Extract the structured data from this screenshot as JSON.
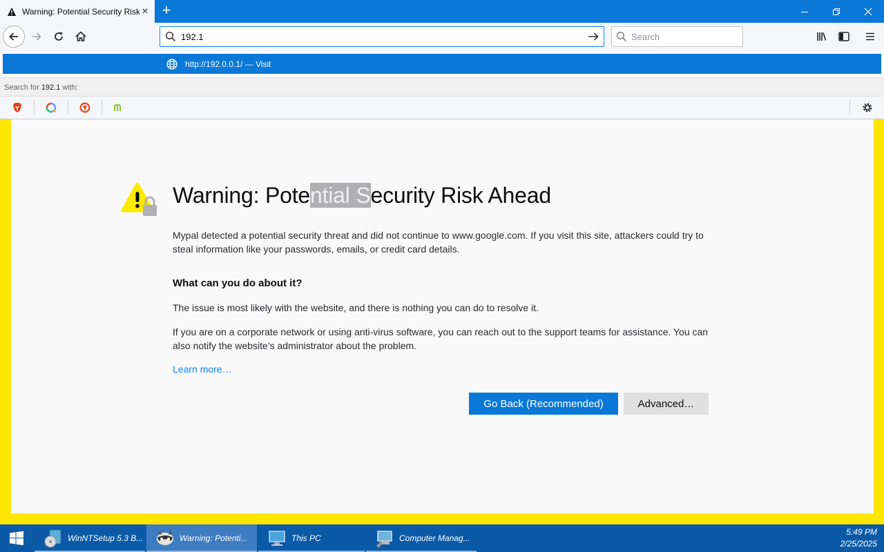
{
  "browser": {
    "tab": {
      "title": "Warning: Potential Security Risk A",
      "icon": "warning-icon"
    },
    "window_controls": [
      "minimize-icon",
      "restore-icon",
      "close-icon"
    ],
    "address_bar": {
      "value": "192.1"
    },
    "search_bar": {
      "placeholder": "Search"
    }
  },
  "url_dropdown": {
    "selected": {
      "url": "http://192.0.0.1/ — Visit",
      "icon": "globe-icon"
    },
    "search_for": {
      "prefix": "Search for",
      "query": "192.1",
      "suffix": "with:"
    },
    "engines": [
      "brave-icon",
      "qwant-icon",
      "duckduckgo-icon",
      "mojeek-icon"
    ]
  },
  "page": {
    "title_pre": "Warning: Pote",
    "title_hl": "ntial S",
    "title_post": "ecurity Risk Ahead",
    "intro": "Mypal detected a potential security threat and did not continue to www.google.com. If you visit this site, attackers could try to steal information like your passwords, emails, or credit card details.",
    "subheading": "What can you do about it?",
    "para1": "The issue is most likely with the website, and there is nothing you can do to resolve it.",
    "para2": "If you are on a corporate network or using anti-virus software, you can reach out to the support teams for assistance. You can also notify the website’s administrator about the problem.",
    "learn_more": "Learn more…",
    "go_back": "Go Back (Recommended)",
    "advanced": "Advanced…"
  },
  "taskbar": {
    "items": [
      {
        "label": "WinNTSetup 5.3 B...",
        "icon": "setup-disc-icon"
      },
      {
        "label": "Warning: Potenti...",
        "icon": "mypal-raccoon-icon",
        "active": true
      },
      {
        "label": "This PC",
        "icon": "this-pc-icon"
      },
      {
        "label": "Computer Manag...",
        "icon": "computer-management-icon"
      }
    ],
    "time": "5:49 PM",
    "date": "2/25/2025"
  },
  "colors": {
    "accent": "#0a78d7",
    "frame": "#ffe600",
    "taskbar": "#0b5aa8",
    "link": "#0a84ff"
  }
}
